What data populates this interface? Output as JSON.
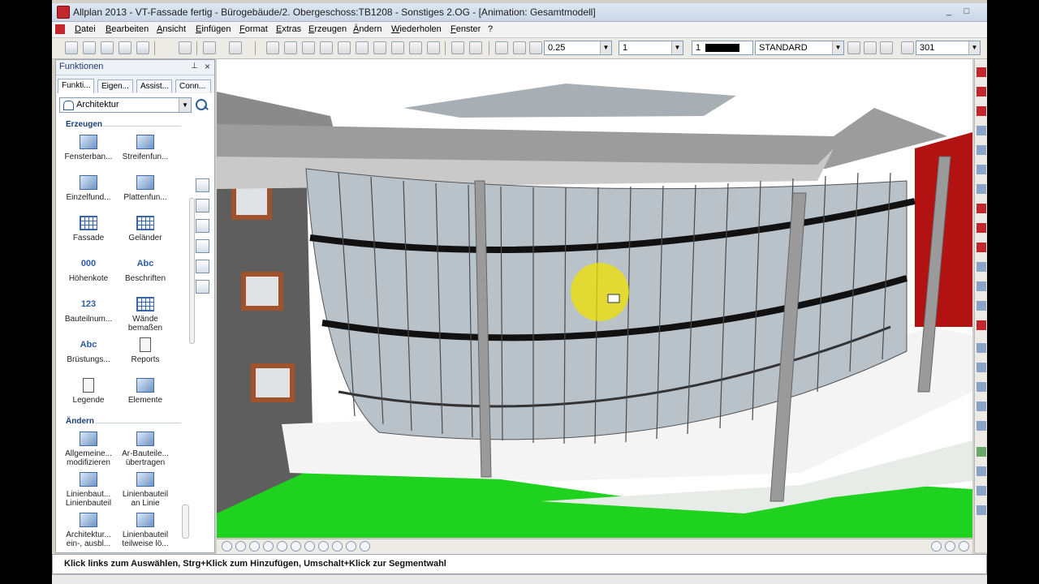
{
  "window": {
    "title": "Allplan 2013 - VT-Fassade fertig - Bürogebäude/2. Obergeschoss:TB1208 - Sonstiges 2.OG - [Animation: Gesamtmodell]",
    "minimize": "_",
    "maximize": "□",
    "close": "×"
  },
  "menu": {
    "items": [
      "Datei",
      "Bearbeiten",
      "Ansicht",
      "Einfügen",
      "Format",
      "Extras",
      "Erzeugen",
      "Ändern",
      "Wiederholen",
      "Fenster",
      "?"
    ]
  },
  "toolbar": {
    "pen_thickness": "0.25",
    "line_type": "1",
    "color_number": "1",
    "layer": "STANDARD",
    "hatch_number": "301"
  },
  "panel": {
    "title": "Funktionen",
    "pin": "⊥",
    "close": "×",
    "tabs": [
      "Funkti...",
      "Eigen...",
      "Assist...",
      "Conn..."
    ],
    "category": "Architektur",
    "sections": {
      "erzeugen": "Erzeugen",
      "aendern": "Ändern"
    },
    "erzeugen_items": [
      {
        "label": "Fensterban...",
        "icon": "windowsill-icon"
      },
      {
        "label": "Streifenfun...",
        "icon": "strip-foundation-icon"
      },
      {
        "label": "Einzelfund...",
        "icon": "single-foundation-icon"
      },
      {
        "label": "Plattenfun...",
        "icon": "slab-foundation-icon"
      },
      {
        "label": "Fassade",
        "icon": "facade-icon"
      },
      {
        "label": "Geländer",
        "icon": "railing-icon"
      },
      {
        "label": "Höhenkote",
        "icon": "elevation-icon",
        "glyph": "000"
      },
      {
        "label": "Beschriften",
        "icon": "label-icon",
        "glyph": "Abc"
      },
      {
        "label": "Bauteilnum...",
        "icon": "numbering-icon",
        "glyph": "123"
      },
      {
        "label": "Wände bemaßen",
        "icon": "wall-dimension-icon"
      },
      {
        "label": "Brüstungs...",
        "icon": "parapet-icon",
        "glyph": "Abc"
      },
      {
        "label": "Reports",
        "icon": "reports-icon"
      },
      {
        "label": "Legende",
        "icon": "legend-icon"
      },
      {
        "label": "Elemente",
        "icon": "elements-icon"
      }
    ],
    "aendern_items": [
      {
        "label": "Allgemeine... modifizieren",
        "icon": "modify-icon"
      },
      {
        "label": "Ar-Bauteile... übertragen",
        "icon": "transfer-icon"
      },
      {
        "label": "Linienbaut... Linienbauteil",
        "icon": "line-component-icon"
      },
      {
        "label": "Linienbauteil an Linie",
        "icon": "line-to-line-icon"
      },
      {
        "label": "Architektur... ein-, ausbl...",
        "icon": "visibility-icon"
      },
      {
        "label": "Linienbauteil teilweise lö...",
        "icon": "partial-delete-icon"
      }
    ]
  },
  "status": {
    "hint": "Klick links zum Auswählen, Strg+Klick zum Hinzufügen, Umschalt+Klick zur Segmentwahl"
  },
  "colors": {
    "accent": "#c1272d",
    "title_bg": "#d7e2ef",
    "grass": "#1fd21f",
    "glass": "#b9c1c9",
    "highlight": "#f0e000"
  }
}
